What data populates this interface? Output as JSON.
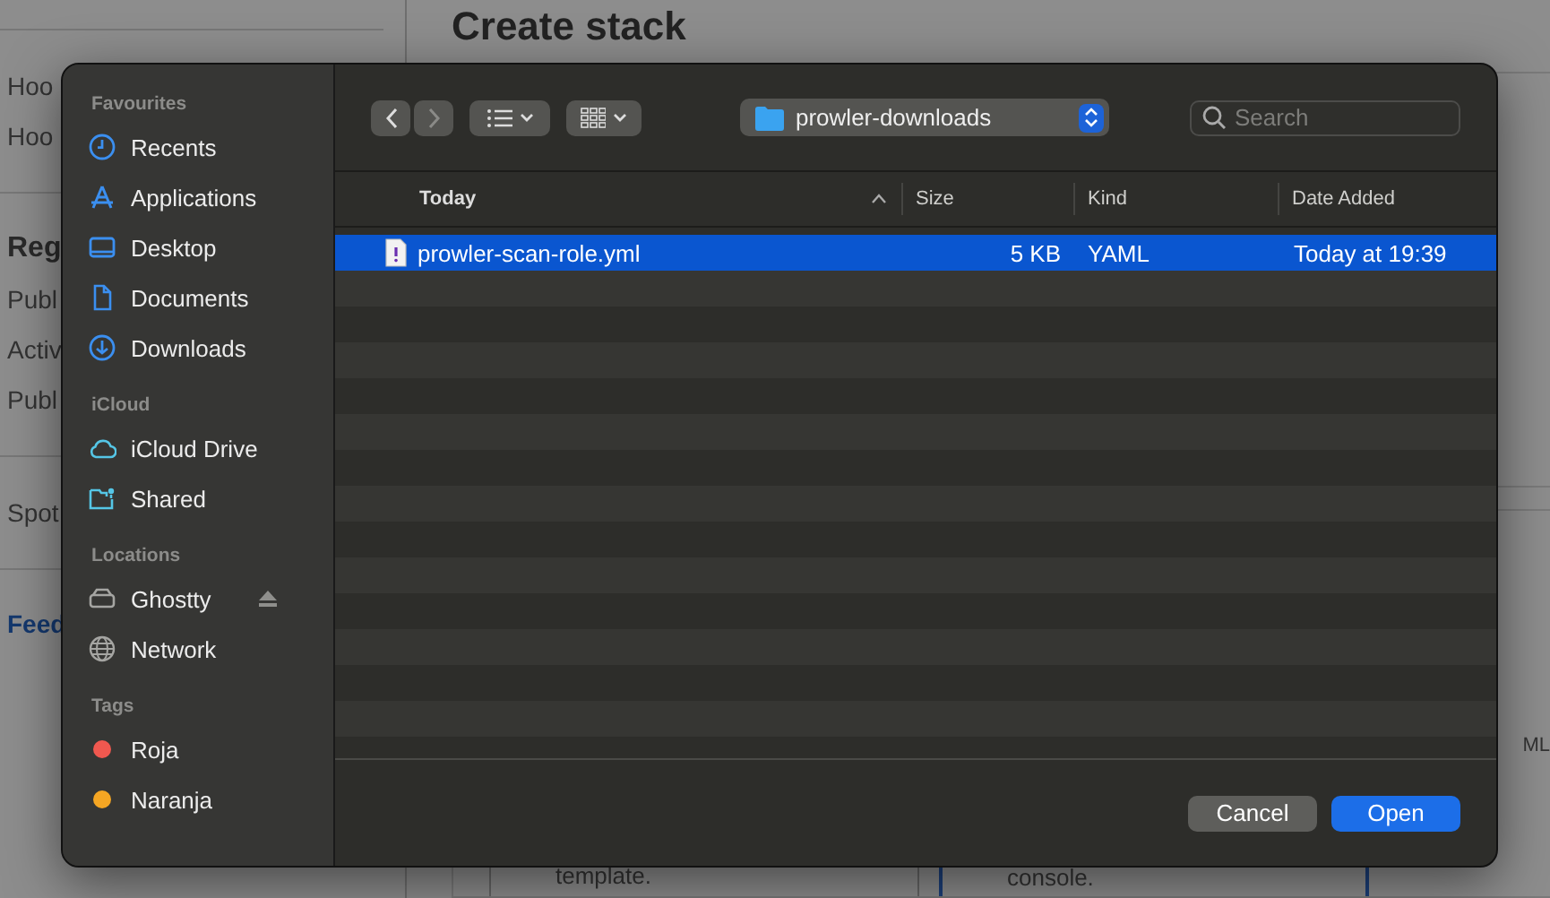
{
  "background": {
    "title": "Create stack",
    "nav_groups": [
      [
        {
          "text": "Hoo",
          "kind": "item"
        },
        {
          "text": "Hoo",
          "kind": "item"
        }
      ],
      [
        {
          "text": "Reg",
          "kind": "heading"
        },
        {
          "text": "Publ",
          "kind": "item"
        },
        {
          "text": "Activ",
          "kind": "item"
        },
        {
          "text": "Publ",
          "kind": "item"
        }
      ],
      [
        {
          "text": "Spot",
          "kind": "item"
        }
      ],
      [
        {
          "text": "Feed",
          "kind": "link"
        }
      ]
    ],
    "side_text": "ML",
    "tiles": [
      {
        "text": "template.",
        "selected": false
      },
      {
        "text": "console.",
        "selected": true
      }
    ]
  },
  "dialog": {
    "sidebar": [
      {
        "heading": "Favourites",
        "items": [
          {
            "label": "Recents"
          },
          {
            "label": "Applications"
          },
          {
            "label": "Desktop"
          },
          {
            "label": "Documents"
          },
          {
            "label": "Downloads"
          }
        ]
      },
      {
        "heading": "iCloud",
        "items": [
          {
            "label": "iCloud Drive"
          },
          {
            "label": "Shared"
          }
        ]
      },
      {
        "heading": "Locations",
        "items": [
          {
            "label": "Ghostty"
          },
          {
            "label": "Network"
          }
        ]
      },
      {
        "heading": "Tags",
        "items": [
          {
            "label": "Roja",
            "color": "#f0584f"
          },
          {
            "label": "Naranja",
            "color": "#f5a623"
          }
        ]
      }
    ],
    "location": "prowler-downloads",
    "search": {
      "placeholder": "Search"
    },
    "columns": [
      {
        "label": "Today",
        "sorted": true
      },
      {
        "label": "Size",
        "sorted": false
      },
      {
        "label": "Kind",
        "sorted": false
      },
      {
        "label": "Date Added",
        "sorted": false
      }
    ],
    "files": [
      {
        "name": "prowler-scan-role.yml",
        "size": "5 KB",
        "file_kind": "YAML",
        "date_added": "Today at 19:39",
        "selected": true
      }
    ],
    "buttons": [
      {
        "label": "Cancel",
        "kind": "secondary"
      },
      {
        "label": "Open",
        "kind": "primary"
      }
    ]
  }
}
